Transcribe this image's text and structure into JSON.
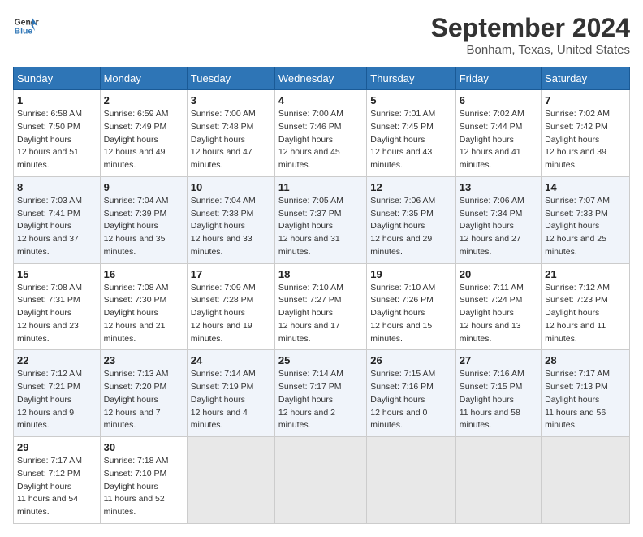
{
  "header": {
    "logo_line1": "General",
    "logo_line2": "Blue",
    "month_title": "September 2024",
    "location": "Bonham, Texas, United States"
  },
  "days_of_week": [
    "Sunday",
    "Monday",
    "Tuesday",
    "Wednesday",
    "Thursday",
    "Friday",
    "Saturday"
  ],
  "weeks": [
    [
      {
        "num": "1",
        "rise": "6:58 AM",
        "set": "7:50 PM",
        "daylight": "12 hours and 51 minutes."
      },
      {
        "num": "2",
        "rise": "6:59 AM",
        "set": "7:49 PM",
        "daylight": "12 hours and 49 minutes."
      },
      {
        "num": "3",
        "rise": "7:00 AM",
        "set": "7:48 PM",
        "daylight": "12 hours and 47 minutes."
      },
      {
        "num": "4",
        "rise": "7:00 AM",
        "set": "7:46 PM",
        "daylight": "12 hours and 45 minutes."
      },
      {
        "num": "5",
        "rise": "7:01 AM",
        "set": "7:45 PM",
        "daylight": "12 hours and 43 minutes."
      },
      {
        "num": "6",
        "rise": "7:02 AM",
        "set": "7:44 PM",
        "daylight": "12 hours and 41 minutes."
      },
      {
        "num": "7",
        "rise": "7:02 AM",
        "set": "7:42 PM",
        "daylight": "12 hours and 39 minutes."
      }
    ],
    [
      {
        "num": "8",
        "rise": "7:03 AM",
        "set": "7:41 PM",
        "daylight": "12 hours and 37 minutes."
      },
      {
        "num": "9",
        "rise": "7:04 AM",
        "set": "7:39 PM",
        "daylight": "12 hours and 35 minutes."
      },
      {
        "num": "10",
        "rise": "7:04 AM",
        "set": "7:38 PM",
        "daylight": "12 hours and 33 minutes."
      },
      {
        "num": "11",
        "rise": "7:05 AM",
        "set": "7:37 PM",
        "daylight": "12 hours and 31 minutes."
      },
      {
        "num": "12",
        "rise": "7:06 AM",
        "set": "7:35 PM",
        "daylight": "12 hours and 29 minutes."
      },
      {
        "num": "13",
        "rise": "7:06 AM",
        "set": "7:34 PM",
        "daylight": "12 hours and 27 minutes."
      },
      {
        "num": "14",
        "rise": "7:07 AM",
        "set": "7:33 PM",
        "daylight": "12 hours and 25 minutes."
      }
    ],
    [
      {
        "num": "15",
        "rise": "7:08 AM",
        "set": "7:31 PM",
        "daylight": "12 hours and 23 minutes."
      },
      {
        "num": "16",
        "rise": "7:08 AM",
        "set": "7:30 PM",
        "daylight": "12 hours and 21 minutes."
      },
      {
        "num": "17",
        "rise": "7:09 AM",
        "set": "7:28 PM",
        "daylight": "12 hours and 19 minutes."
      },
      {
        "num": "18",
        "rise": "7:10 AM",
        "set": "7:27 PM",
        "daylight": "12 hours and 17 minutes."
      },
      {
        "num": "19",
        "rise": "7:10 AM",
        "set": "7:26 PM",
        "daylight": "12 hours and 15 minutes."
      },
      {
        "num": "20",
        "rise": "7:11 AM",
        "set": "7:24 PM",
        "daylight": "12 hours and 13 minutes."
      },
      {
        "num": "21",
        "rise": "7:12 AM",
        "set": "7:23 PM",
        "daylight": "12 hours and 11 minutes."
      }
    ],
    [
      {
        "num": "22",
        "rise": "7:12 AM",
        "set": "7:21 PM",
        "daylight": "12 hours and 9 minutes."
      },
      {
        "num": "23",
        "rise": "7:13 AM",
        "set": "7:20 PM",
        "daylight": "12 hours and 7 minutes."
      },
      {
        "num": "24",
        "rise": "7:14 AM",
        "set": "7:19 PM",
        "daylight": "12 hours and 4 minutes."
      },
      {
        "num": "25",
        "rise": "7:14 AM",
        "set": "7:17 PM",
        "daylight": "12 hours and 2 minutes."
      },
      {
        "num": "26",
        "rise": "7:15 AM",
        "set": "7:16 PM",
        "daylight": "12 hours and 0 minutes."
      },
      {
        "num": "27",
        "rise": "7:16 AM",
        "set": "7:15 PM",
        "daylight": "11 hours and 58 minutes."
      },
      {
        "num": "28",
        "rise": "7:17 AM",
        "set": "7:13 PM",
        "daylight": "11 hours and 56 minutes."
      }
    ],
    [
      {
        "num": "29",
        "rise": "7:17 AM",
        "set": "7:12 PM",
        "daylight": "11 hours and 54 minutes."
      },
      {
        "num": "30",
        "rise": "7:18 AM",
        "set": "7:10 PM",
        "daylight": "11 hours and 52 minutes."
      },
      null,
      null,
      null,
      null,
      null
    ]
  ]
}
